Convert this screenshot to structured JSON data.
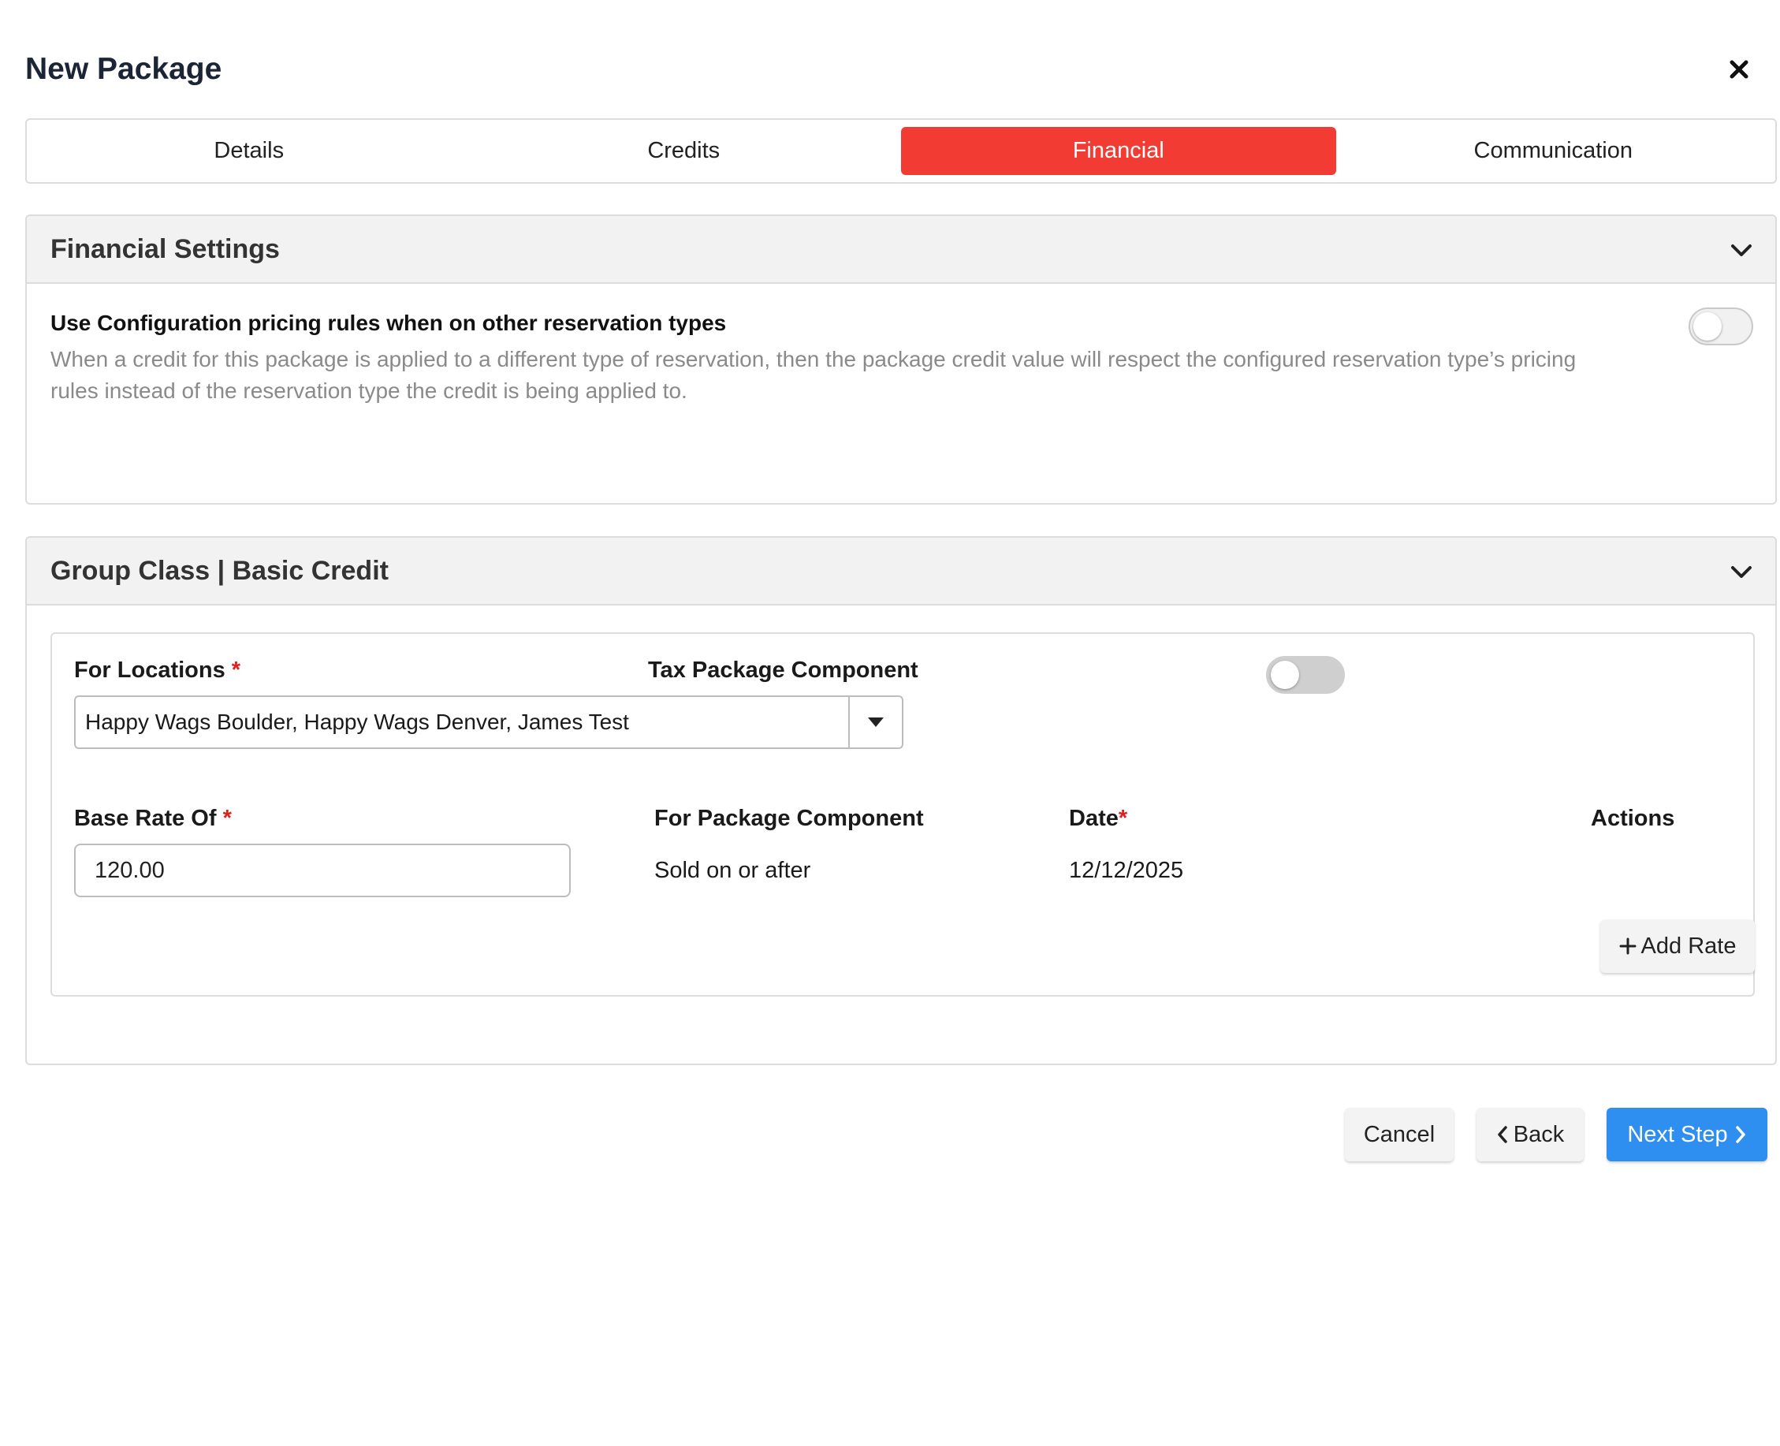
{
  "header": {
    "title": "New Package"
  },
  "tabs": [
    {
      "label": "Details"
    },
    {
      "label": "Credits"
    },
    {
      "label": "Financial"
    },
    {
      "label": "Communication"
    }
  ],
  "active_tab": "Financial",
  "financial_settings": {
    "title": "Financial Settings",
    "setting_title": "Use Configuration pricing rules when on other reservation types",
    "setting_desc": "When a credit for this package is applied to a different type of reservation, then the package credit value will respect the configured reservation type’s pricing rules instead of the reservation type the credit is being applied to.",
    "toggle_on": false
  },
  "group_class": {
    "title": "Group Class | Basic Credit",
    "for_locations_label": "For Locations",
    "required_mark": "*",
    "locations_value": "Happy Wags Boulder, Happy Wags Denver, James Test",
    "tax_label": "Tax Package Component",
    "tax_toggle_on": false,
    "base_rate_label": "Base Rate Of",
    "base_rate_value": "120.00",
    "component_label": "For Package Component",
    "component_value": "Sold on or after",
    "date_label": "Date",
    "date_value": "12/12/2025",
    "actions_label": "Actions",
    "add_rate_label": "Add Rate"
  },
  "footer": {
    "cancel_label": "Cancel",
    "back_label": "Back",
    "next_label": "Next Step"
  },
  "colors": {
    "active_tab": "#f23b33",
    "primary_button": "#2f8ff0",
    "required": "#e01e1e"
  }
}
